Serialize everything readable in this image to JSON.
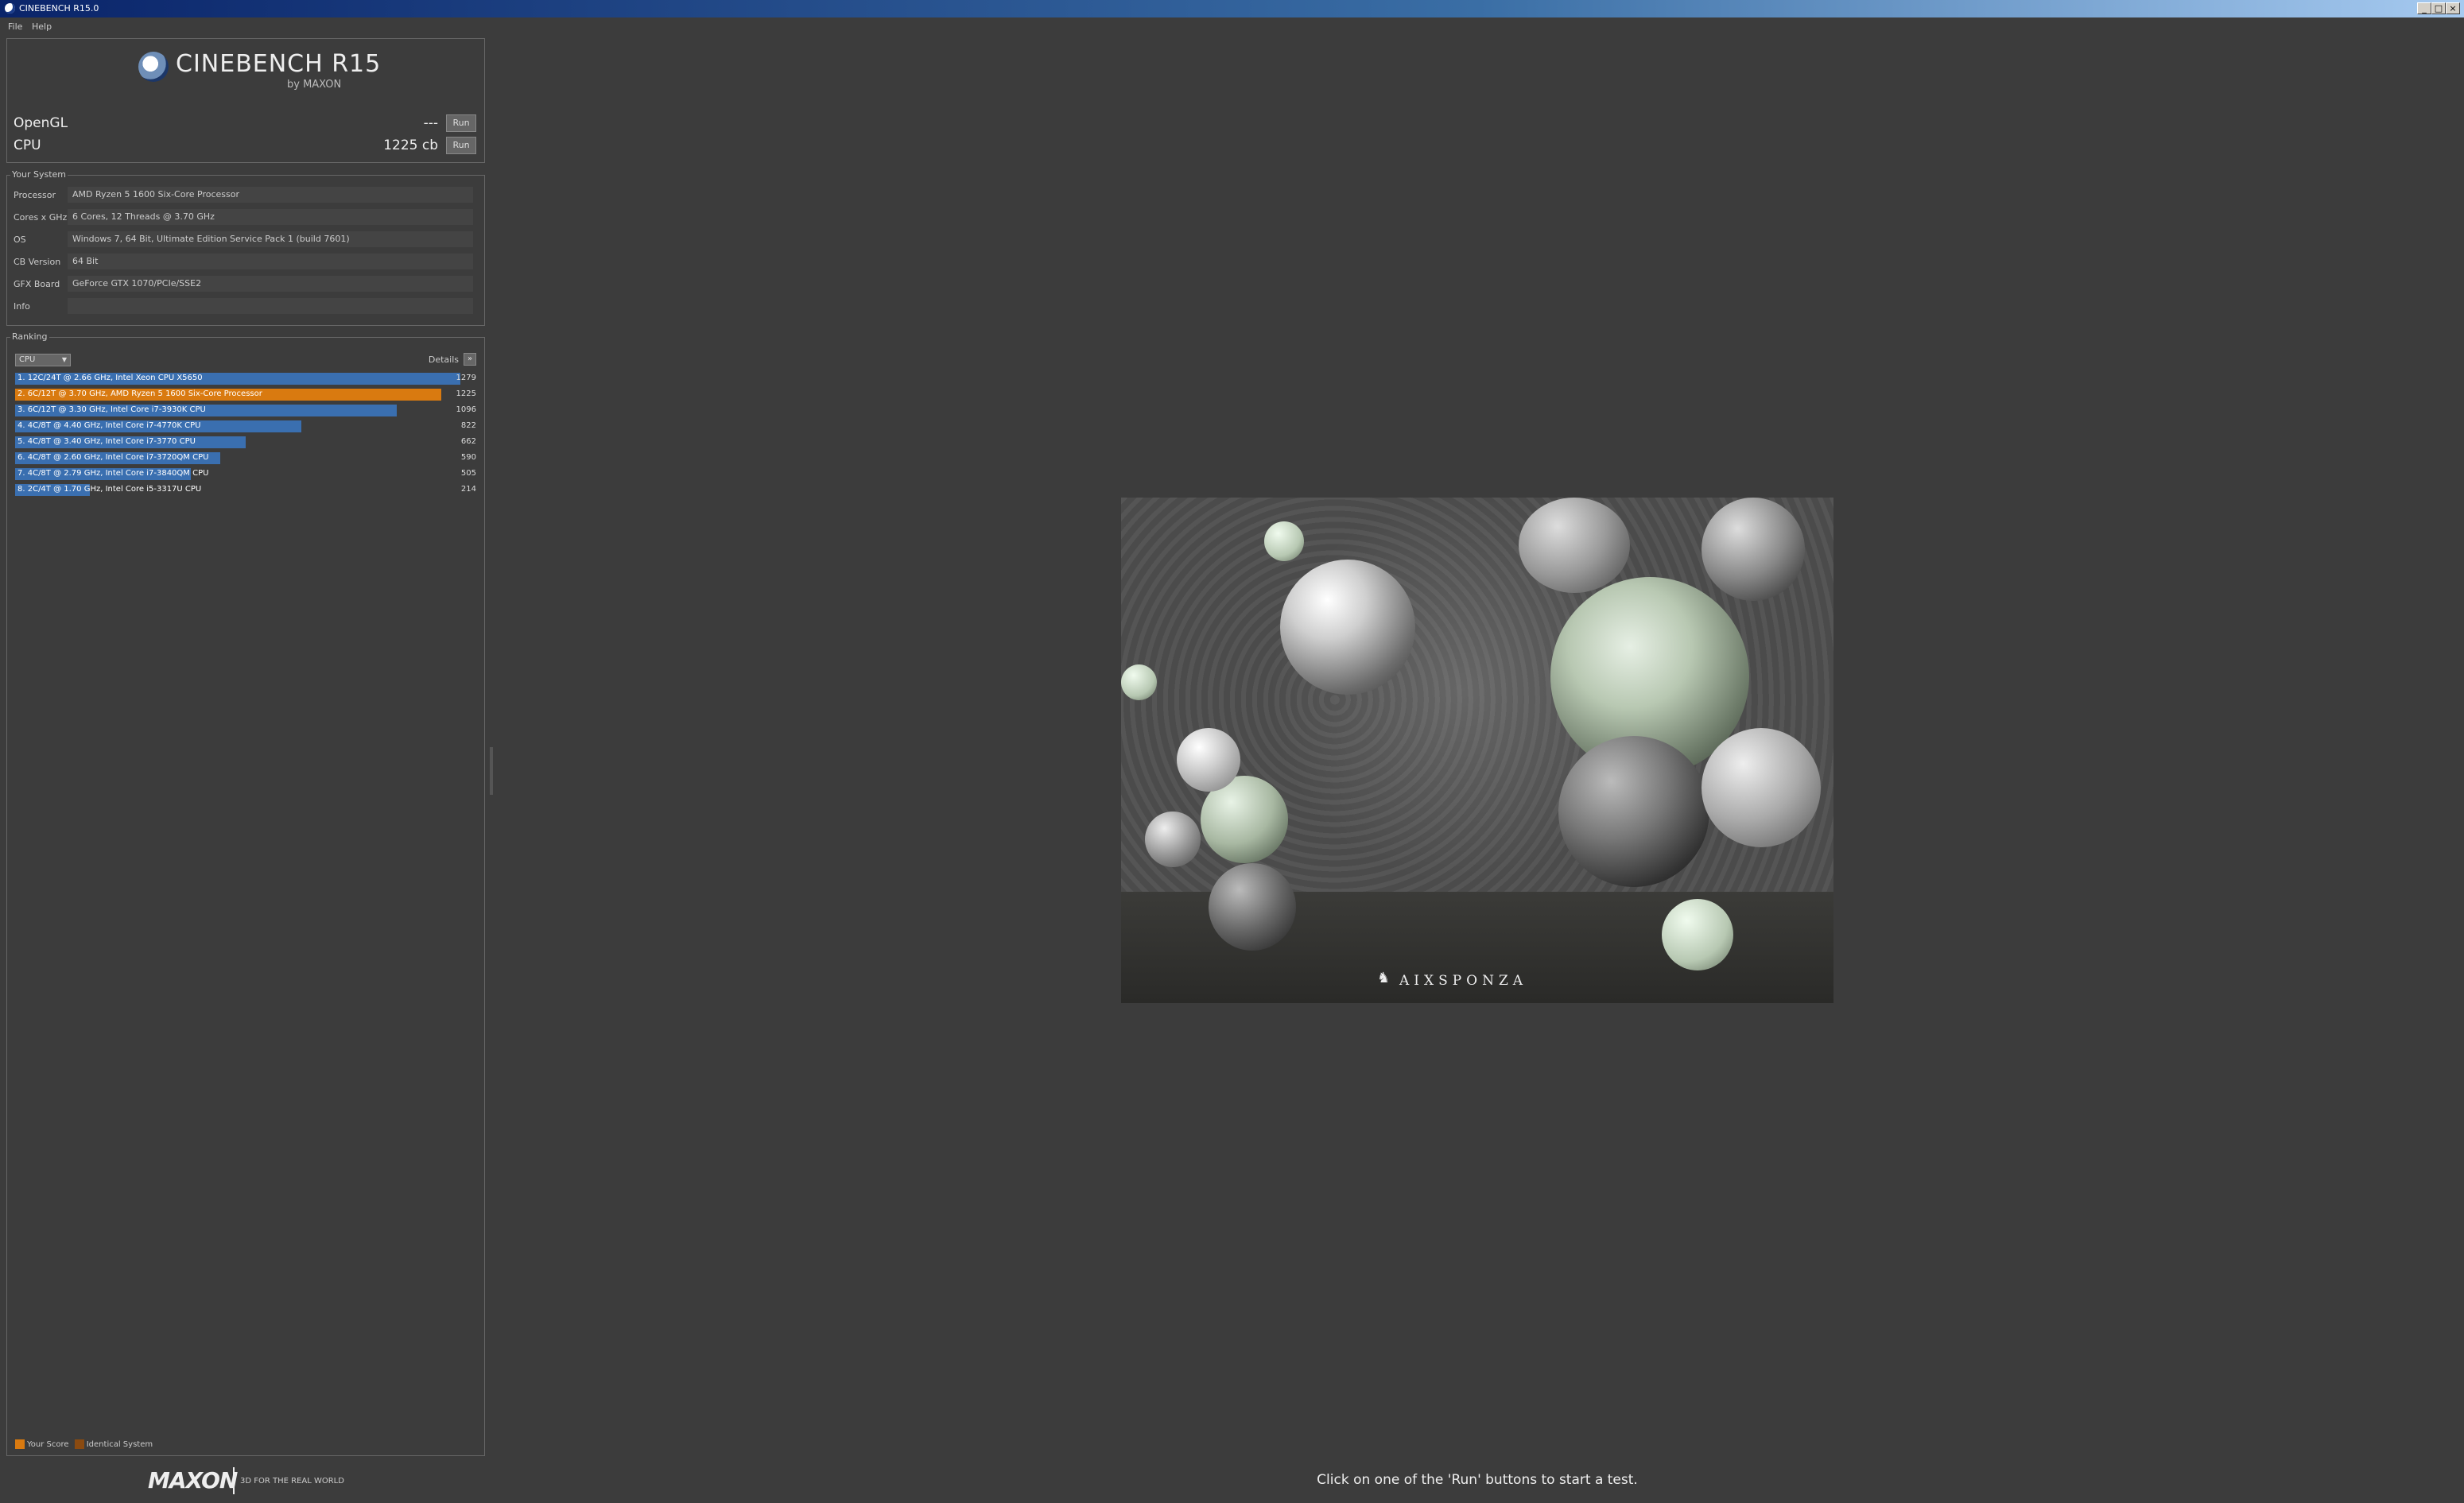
{
  "window": {
    "title": "CINEBENCH R15.0"
  },
  "menu": [
    "File",
    "Help"
  ],
  "logo": {
    "name": "CINEBENCH R15",
    "by": "by MAXON"
  },
  "tests": [
    {
      "label": "OpenGL",
      "score": "---",
      "button": "Run"
    },
    {
      "label": "CPU",
      "score": "1225 cb",
      "button": "Run"
    }
  ],
  "system": {
    "title": "Your System",
    "rows": [
      {
        "label": "Processor",
        "value": "AMD Ryzen 5 1600 Six-Core Processor"
      },
      {
        "label": "Cores x GHz",
        "value": "6 Cores, 12 Threads @ 3.70 GHz"
      },
      {
        "label": "OS",
        "value": "Windows 7, 64 Bit, Ultimate Edition Service Pack 1 (build 7601)"
      },
      {
        "label": "CB Version",
        "value": "64 Bit"
      },
      {
        "label": "GFX Board",
        "value": "GeForce GTX 1070/PCIe/SSE2"
      },
      {
        "label": "Info",
        "value": ""
      }
    ]
  },
  "ranking": {
    "title": "Ranking",
    "selector": "CPU",
    "details_label": "Details",
    "max_score": 1279,
    "rows": [
      {
        "label": "1. 12C/24T @ 2.66 GHz, Intel Xeon CPU X5650",
        "score": 1279,
        "score_text": "1279",
        "highlight": false
      },
      {
        "label": "2. 6C/12T @ 3.70 GHz, AMD Ryzen 5 1600 Six-Core Processor",
        "score": 1225,
        "score_text": "1225",
        "highlight": true
      },
      {
        "label": "3. 6C/12T @ 3.30 GHz,  Intel Core i7-3930K CPU",
        "score": 1096,
        "score_text": "1096",
        "highlight": false
      },
      {
        "label": "4. 4C/8T @ 4.40 GHz, Intel Core i7-4770K CPU",
        "score": 822,
        "score_text": "822",
        "highlight": false
      },
      {
        "label": "5. 4C/8T @ 3.40 GHz,  Intel Core i7-3770 CPU",
        "score": 662,
        "score_text": "662",
        "highlight": false
      },
      {
        "label": "6. 4C/8T @ 2.60 GHz, Intel Core i7-3720QM CPU",
        "score": 590,
        "score_text": "590",
        "highlight": false
      },
      {
        "label": "7. 4C/8T @ 2.79 GHz,  Intel Core i7-3840QM CPU",
        "score": 505,
        "score_text": "505",
        "highlight": false
      },
      {
        "label": "8. 2C/4T @ 1.70 GHz,  Intel Core i5-3317U CPU",
        "score": 214,
        "score_text": "214",
        "highlight": false
      }
    ],
    "legend": [
      {
        "label": "Your Score",
        "color": "#d97a10"
      },
      {
        "label": "Identical System",
        "color": "#8a4a10"
      }
    ]
  },
  "colors": {
    "bar_blue": "#3a6fb0",
    "bar_orange": "#d97a10"
  },
  "footer": {
    "brand": "MAXON",
    "tagline": "3D FOR THE REAL WORLD"
  },
  "render": {
    "watermark": "AIXSPONZA"
  },
  "status": "Click on one of the 'Run' buttons to start a test."
}
